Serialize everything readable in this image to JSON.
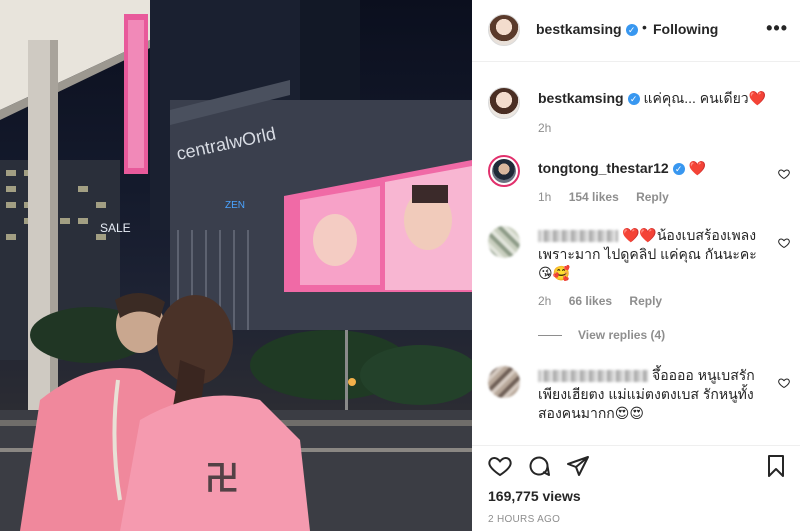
{
  "media": {
    "billboard_text": "centralwOrld",
    "small_sign": "ZEN",
    "left_sign": "SALE"
  },
  "header": {
    "username": "bestkamsing",
    "verified_mark": "✓",
    "separator": "•",
    "follow_label": "Following",
    "more_label": "•••"
  },
  "caption": {
    "username": "bestkamsing",
    "text": "แค่คุณ... คนเดียว❤️",
    "time": "2h"
  },
  "comments": [
    {
      "username": "tongtong_thestar12",
      "text": "❤️",
      "time": "1h",
      "likes": "154 likes",
      "reply_label": "Reply"
    },
    {
      "username_hidden": true,
      "text": "❤️❤️น้องเบสร้องเพลงเพราะมาก ไปดูคลิป แค่คุณ กันนะคะ 😘🥰",
      "time": "2h",
      "likes": "66 likes",
      "reply_label": "Reply",
      "view_replies": "View replies (4)"
    },
    {
      "username_hidden": true,
      "text": "จึ้ออออ หนูเบสรักเพียงเฮียตง แม่แม่ตงตงเบส รักหนูทั้งสองคนมากก😍😍"
    }
  ],
  "footer": {
    "views": "169,775 views",
    "posted": "2 HOURS AGO"
  },
  "colors": {
    "verified": "#3897f0",
    "muted": "#8e8e8e",
    "text": "#262626",
    "heart": "#ed4956",
    "billboard_pink": "#f06aa6"
  },
  "icons": [
    "heart-icon",
    "comment-icon",
    "share-icon",
    "bookmark-icon",
    "more-icon",
    "verified-icon"
  ]
}
